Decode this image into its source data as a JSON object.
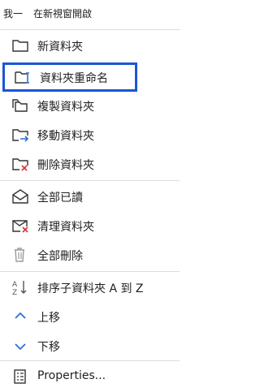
{
  "top_bar": {
    "left_text": "我一",
    "right_text": "在新視窗開啟"
  },
  "menu": {
    "items": [
      {
        "label": "新資料夾",
        "icon": "new-folder-icon"
      },
      {
        "label": "資料夾重命名",
        "icon": "rename-folder-icon"
      },
      {
        "label": "複製資料夾",
        "icon": "copy-folder-icon"
      },
      {
        "label": "移動資料夾",
        "icon": "move-folder-icon"
      },
      {
        "label": "刪除資料夾",
        "icon": "delete-folder-icon"
      },
      {
        "label": "全部已讀",
        "icon": "mark-all-read-icon"
      },
      {
        "label": "清理資料夾",
        "icon": "clean-folder-icon"
      },
      {
        "label": "全部刪除",
        "icon": "delete-all-icon"
      },
      {
        "label": "排序子資料夾 A 到 Z",
        "icon": "sort-az-icon"
      },
      {
        "label": "上移",
        "icon": "chevron-up-icon"
      },
      {
        "label": "下移",
        "icon": "chevron-down-icon"
      },
      {
        "label": "Properties...",
        "icon": "properties-icon"
      }
    ]
  },
  "colors": {
    "selection_border": "#1a56d6",
    "accent_blue": "#2b6fd6",
    "delete_red": "#d13438",
    "icon_gray": "#333333"
  }
}
